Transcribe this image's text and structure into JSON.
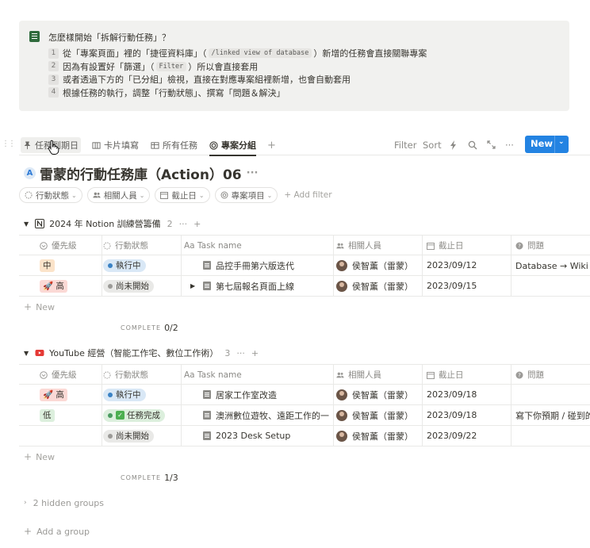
{
  "callout": {
    "title": "怎麼樣開始「拆解行動任務」？",
    "items": [
      {
        "num": "1",
        "pre": "從「專案頁面」裡的「捷徑資料庫」（",
        "code": "/linked view of database",
        "post": "）新增的任務會直接關聯專案"
      },
      {
        "num": "2",
        "pre": "因為有設置好「篩選」（",
        "code": "Filter",
        "post": "）所以會直接套用"
      },
      {
        "num": "3",
        "pre": "或者透過下方的「已分組」檢視，直接在對應專案組裡新增，也會自動套用",
        "code": "",
        "post": ""
      },
      {
        "num": "4",
        "pre": "根據任務的執行，調整「行動狀態」、撰寫「問題＆解決」",
        "code": "",
        "post": ""
      }
    ]
  },
  "views": {
    "tabs": [
      "任務到期日",
      "卡片填寫",
      "所有任務",
      "專案分組"
    ],
    "add": "+",
    "tools": {
      "filter": "Filter",
      "sort": "Sort",
      "new": "New"
    }
  },
  "database": {
    "title": "雷蒙的行動任務庫（Action）06",
    "more": "···",
    "filters": [
      "行動狀態",
      "相關人員",
      "截止日",
      "專案項目"
    ],
    "add_filter": "+ Add filter"
  },
  "columns": [
    "優先級",
    "行動狀態",
    "Aa Task name",
    "相關人員",
    "截止日",
    "問題"
  ],
  "groups": [
    {
      "name": "2024 年 Notion 訓練營籌備",
      "count": "2",
      "rows": [
        {
          "priority": "中",
          "priority_level": "mid",
          "status": "執行中",
          "status_type": "doing",
          "task": "品控手冊第六版迭代",
          "person": "侯智薰（雷蒙）",
          "date": "2023/09/12",
          "problem": "Database → Wiki 遷",
          "expand": ""
        },
        {
          "priority": "🚀 高",
          "priority_level": "high",
          "status": "尚未開始",
          "status_type": "todo",
          "task": "第七屆報名頁面上線",
          "person": "侯智薰（雷蒙）",
          "date": "2023/09/15",
          "problem": "",
          "expand": "▶"
        }
      ],
      "new_label": "New",
      "complete_label": "COMPLETE",
      "complete_value": "0/2"
    },
    {
      "name": "YouTube 經營（智能工作宅、數位工作術）",
      "count": "3",
      "rows": [
        {
          "priority": "🚀 高",
          "priority_level": "high",
          "status": "執行中",
          "status_type": "doing",
          "task": "居家工作室改造",
          "person": "侯智薰（雷蒙）",
          "date": "2023/09/18",
          "problem": "",
          "expand": ""
        },
        {
          "priority": "低",
          "priority_level": "low",
          "status": "任務完成",
          "status_type": "done",
          "task": "澳洲數位遊牧、遠距工作的一",
          "person": "侯智薰（雷蒙）",
          "date": "2023/09/18",
          "problem": "寫下你預期 / 碰到的",
          "expand": ""
        },
        {
          "priority": "",
          "priority_level": "",
          "status": "尚未開始",
          "status_type": "todo",
          "task": "2023 Desk Setup",
          "person": "侯智薰（雷蒙）",
          "date": "2023/09/22",
          "problem": "",
          "expand": ""
        }
      ],
      "new_label": "New",
      "complete_label": "COMPLETE",
      "complete_value": "1/3"
    }
  ],
  "hidden_groups": "2 hidden groups",
  "add_group": "Add a group",
  "colors": {
    "accent": "#2383e2",
    "text": "#37352f",
    "muted": "#9b9a97"
  }
}
